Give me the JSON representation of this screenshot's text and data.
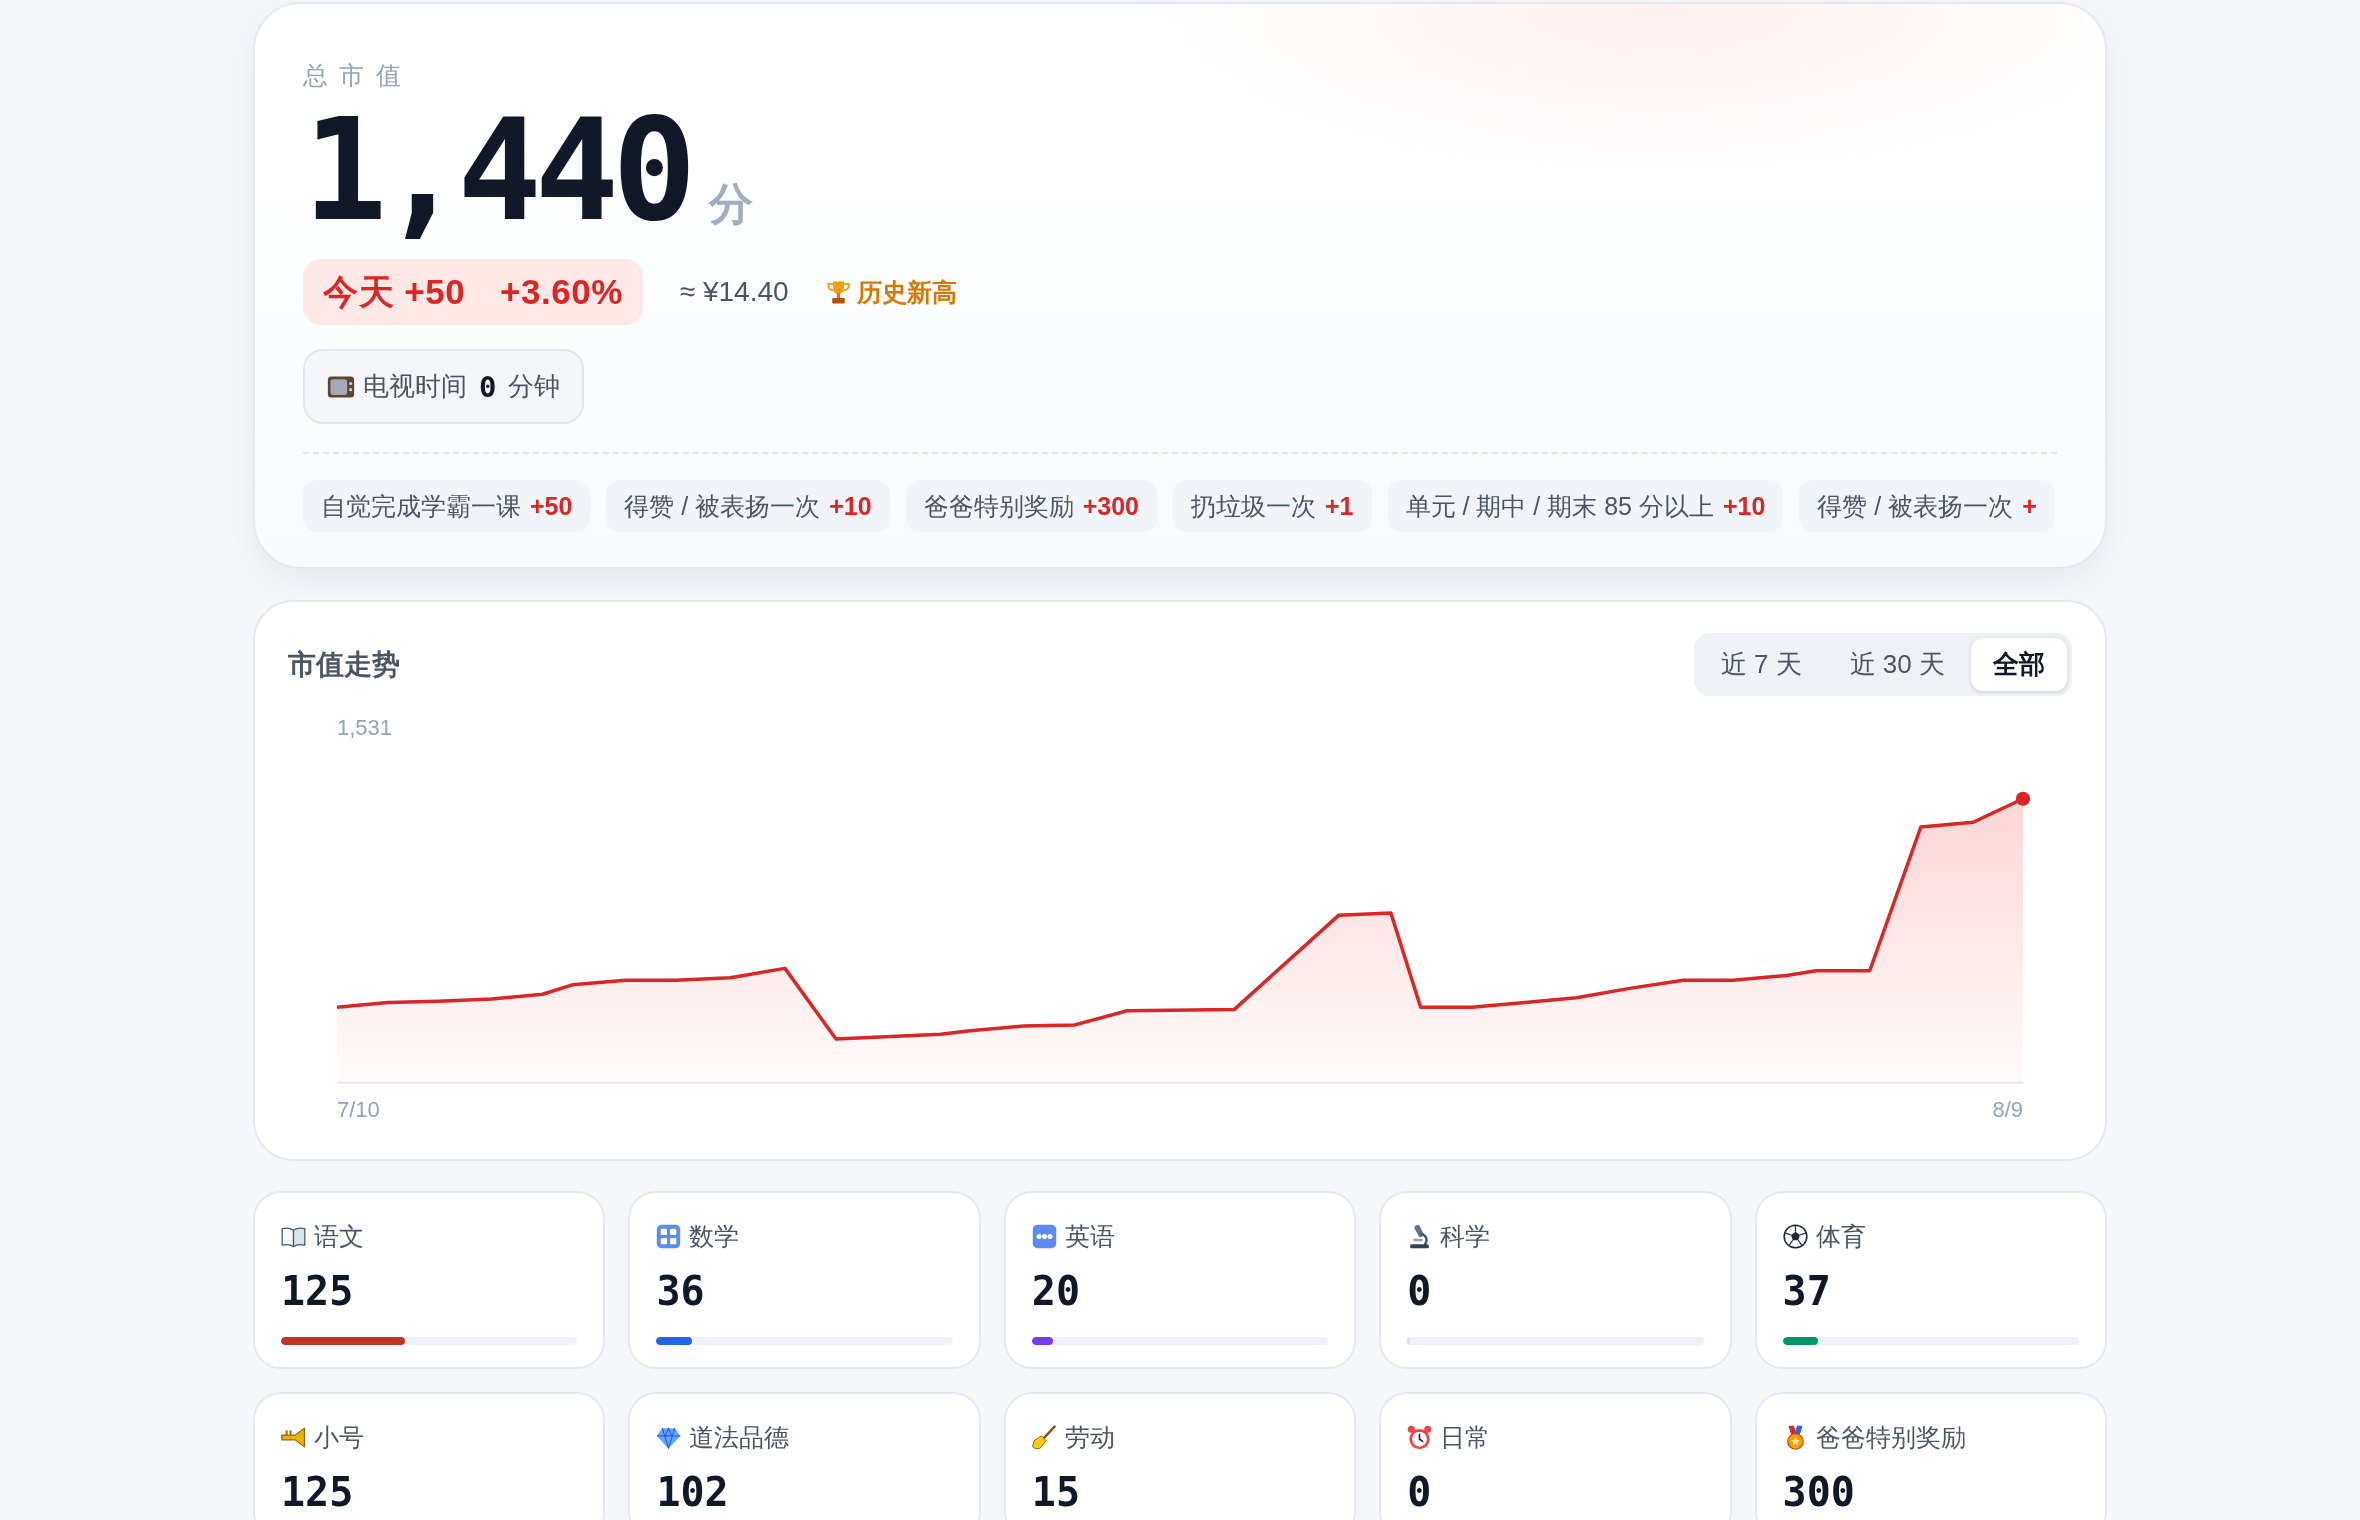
{
  "summary": {
    "label": "总市值",
    "value": "1,440",
    "unit": "分",
    "today_change": "今天 +50",
    "percent_change": "+3.60%",
    "cash_value": "≈ ¥14.40",
    "record_badge": "历史新高",
    "tv_time": {
      "label": "电视时间",
      "value": "0",
      "unit": "分钟"
    },
    "recent_rewards": [
      {
        "label": "自觉完成学霸一课",
        "points": "+50"
      },
      {
        "label": "得赞 / 被表扬一次",
        "points": "+10"
      },
      {
        "label": "爸爸特别奖励",
        "points": "+300"
      },
      {
        "label": "扔垃圾一次",
        "points": "+1"
      },
      {
        "label": "单元 / 期中 / 期末 85 分以上",
        "points": "+10"
      },
      {
        "label": "得赞 / 被表扬一次",
        "points": "+"
      }
    ]
  },
  "trend": {
    "title": "市值走势",
    "ranges": [
      {
        "label": "近 7 天",
        "selected": false
      },
      {
        "label": "近 30 天",
        "selected": false
      },
      {
        "label": "全部",
        "selected": true
      }
    ],
    "y_label": "1,531",
    "x_labels": [
      "7/10",
      "8/9"
    ]
  },
  "subjects": [
    {
      "name": "语文",
      "score": "125",
      "level": 0.42,
      "color": "#c2352b"
    },
    {
      "name": "数学",
      "score": "36",
      "level": 0.12,
      "color": "#2563eb"
    },
    {
      "name": "英语",
      "score": "20",
      "level": 0.07,
      "color": "#7c3aed"
    },
    {
      "name": "科学",
      "score": "0",
      "level": 0
    },
    {
      "name": "体育",
      "score": "37",
      "level": 0.12,
      "color": "#059669"
    },
    {
      "name": "小号",
      "score": "125"
    },
    {
      "name": "道法品德",
      "score": "102"
    },
    {
      "name": "劳动",
      "score": "15"
    },
    {
      "name": "日常",
      "score": "0"
    },
    {
      "name": "爸爸特别奖励",
      "score": "300"
    }
  ]
}
